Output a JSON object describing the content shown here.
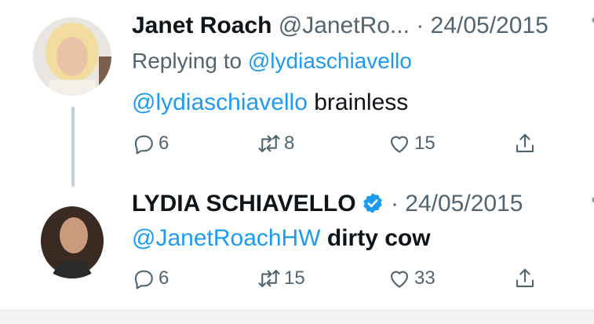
{
  "tweets": [
    {
      "name": "Janet Roach",
      "handle": "@JanetRo...",
      "separator": "·",
      "date": "24/05/2015",
      "replying_prefix": "Replying to ",
      "replying_to": "@lydiaschiavello",
      "mention": "@lydiaschiavello",
      "text": " brainless",
      "counts": {
        "replies": "6",
        "retweets": "8",
        "likes": "15"
      }
    },
    {
      "name": "LYDIA SCHIAVELLO",
      "separator": "·",
      "date": "24/05/2015",
      "mention": "@JanetRoachHW",
      "text": " dirty cow",
      "counts": {
        "replies": "6",
        "retweets": "15",
        "likes": "33"
      }
    }
  ],
  "colors": {
    "accent": "#1d9bf0",
    "muted": "#536471",
    "text": "#0f1419",
    "thread_line": "#c4cfd6"
  },
  "icons": [
    "reply-icon",
    "retweet-icon",
    "like-icon",
    "share-icon",
    "verified-badge-icon"
  ]
}
